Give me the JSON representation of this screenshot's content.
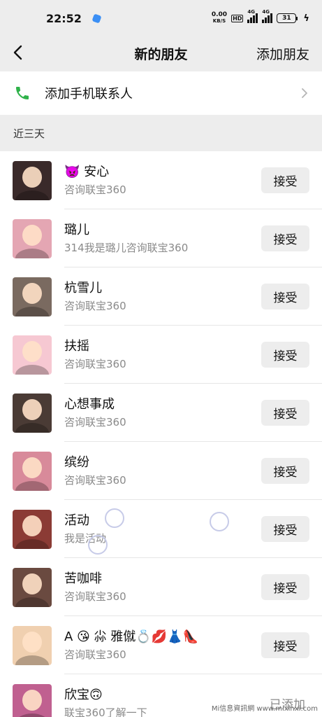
{
  "status_bar": {
    "time": "22:52",
    "speed_top": "0.00",
    "speed_unit": "KB/S",
    "hd_badge": "HD",
    "net1": "4G",
    "net2": "4G",
    "battery": "31",
    "app_icon_color": "#3b8ff5"
  },
  "nav": {
    "title": "新的朋友",
    "action": "添加朋友"
  },
  "add_contacts": {
    "label": "添加手机联系人",
    "icon": "phone-icon",
    "icon_color": "#2fb24a"
  },
  "section": {
    "title": "近三天"
  },
  "requests": [
    {
      "name": "👿 安心",
      "message": "咨询联宝360",
      "action": "接受"
    },
    {
      "name": "璐儿",
      "message": "314我是璐儿咨询联宝360",
      "action": "接受"
    },
    {
      "name": "杭雪儿",
      "message": "咨询联宝360",
      "action": "接受"
    },
    {
      "name": "扶摇",
      "message": "咨询联宝360",
      "action": "接受"
    },
    {
      "name": "心想事成",
      "message": "咨询联宝360",
      "action": "接受"
    },
    {
      "name": "缤纷",
      "message": "咨询联宝360",
      "action": "接受"
    },
    {
      "name": "活动",
      "message": "我是活动",
      "action": "接受"
    },
    {
      "name": "苦咖啡",
      "message": "咨询联宝360",
      "action": "接受"
    },
    {
      "name": "A 😘 尛 雅僦💍💋👗👠",
      "message": "咨询联宝360",
      "action": "接受"
    },
    {
      "name": "欣宝🙃",
      "message": "联宝360了解一下",
      "status": "已添加"
    }
  ],
  "colors": {
    "avatar_1": "#3a2a2a",
    "avatar_2": "#e4a6b3",
    "avatar_3": "#7a6a60",
    "avatar_4": "#f6c8d2",
    "avatar_5": "#4a3b35",
    "avatar_6": "#d88a9a",
    "avatar_7": "#8b3b35",
    "avatar_8": "#6a4a40",
    "avatar_9": "#f0d0b0",
    "avatar_10": "#c06090"
  },
  "watermark": "Mi信息資訊網 www.mixinxi.com"
}
